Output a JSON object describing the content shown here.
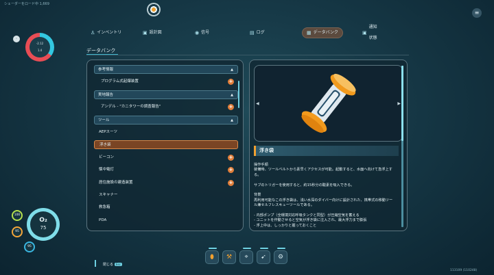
{
  "status_text": "シェーダーをロード中 1,669",
  "coords": "113109 (110248)",
  "tabs": [
    {
      "label": "インベントリ",
      "icon": "person-icon"
    },
    {
      "label": "設計図",
      "icon": "blueprint-icon"
    },
    {
      "label": "信号",
      "icon": "signal-icon"
    },
    {
      "label": "ログ",
      "icon": "log-icon"
    },
    {
      "label": "データバンク",
      "icon": "databank-icon",
      "active": true
    },
    {
      "label": "通知状態",
      "icon": "notification-icon"
    }
  ],
  "section_title": "データバンク",
  "list": [
    {
      "type": "header",
      "label": "参考情報"
    },
    {
      "type": "item",
      "label": "プログラム式起爆装置",
      "new": true
    },
    {
      "type": "header",
      "label": "実地報告"
    },
    {
      "type": "item",
      "label": "アンデル - \"カニタワーの調査報告\"",
      "new": true
    },
    {
      "type": "header",
      "label": "ツール"
    },
    {
      "type": "item",
      "label": "AEPスーツ",
      "new": false
    },
    {
      "type": "item",
      "label": "浮き袋",
      "selected": true
    },
    {
      "type": "item",
      "label": "ビーコン",
      "new": true
    },
    {
      "type": "item",
      "label": "懐中電灯",
      "new": true
    },
    {
      "type": "item",
      "label": "居住施設の建造装置",
      "new": true
    },
    {
      "type": "item",
      "label": "スキャナー",
      "new": false
    },
    {
      "type": "item",
      "label": "救急箱",
      "new": false
    },
    {
      "type": "item",
      "label": "PDA",
      "new": false
    }
  ],
  "entry": {
    "title": "浮き袋",
    "body": "操作手順\n装備時、ツールベルトから素早くアクセスが可能。起動すると、水面へ向けて急浮上する。\n\nサブのトリガーを使用すると、約15秒分の酸素を吸入できる。\n\n背景\n再利用可能なこの浮き袋は、浅い水深のダイバー向けに設計された、携帯式の移動ツール兼セルフレスキューツールである。\n\n- 内部ポンプ（全環境対応呼吸タンクと同型）が圧縮空気を蓄える\n- ユニットを作動させると空気が浮き袋に注入され、最大浮力まで膨張\n- 浮上中は、しっかりと握っておくこと"
  },
  "hud": {
    "gauge_text_1": "-2.12",
    "gauge_text_2": "1.4",
    "small_btn": "◦",
    "o2_label": "O₂",
    "o2_value": "75",
    "food": "100",
    "water": "95",
    "temp": "95"
  },
  "hotbar": [
    "bladder-icon",
    "hammer-icon",
    "scanner-icon",
    "seaglide-icon",
    "builder-icon"
  ],
  "close_hint": {
    "label": "閉じる",
    "key": "Esc"
  },
  "colors": {
    "accent": "#f0a030",
    "selected": "#7a4524",
    "cyan": "#6fd1e2"
  }
}
